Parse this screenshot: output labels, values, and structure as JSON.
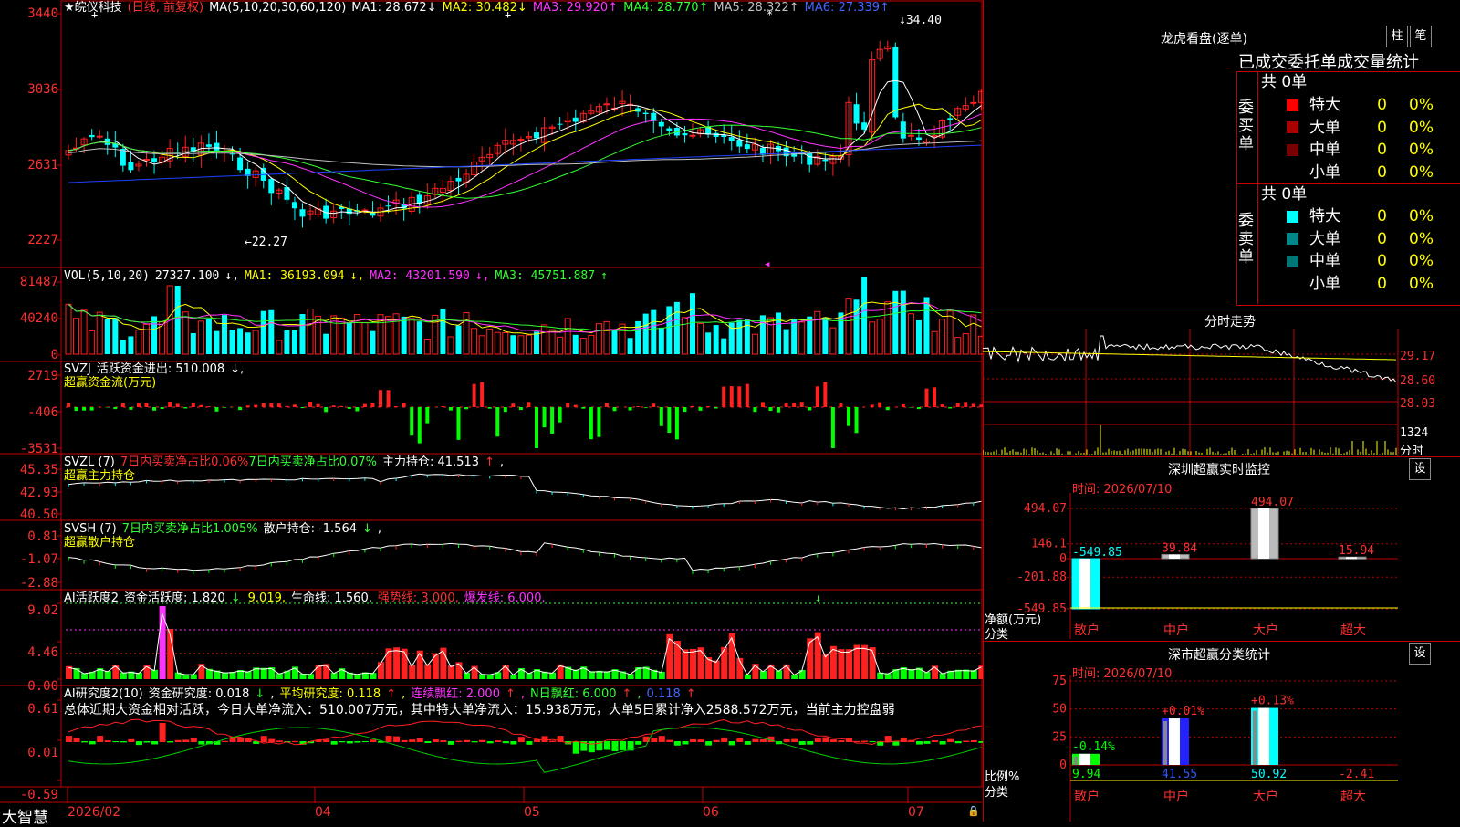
{
  "app": {
    "brand": "大智慧",
    "stock_name": "皖仪科技",
    "period": "(日线, 前复权)"
  },
  "price": {
    "y_labels": [
      "3440",
      "3036",
      "2631",
      "2227"
    ],
    "ma_header": "MA(5,10,20,30,60,120)",
    "ma": [
      {
        "label": "MA1:",
        "value": "28.672",
        "arrow": "↓",
        "color": "#ffffff"
      },
      {
        "label": "MA2:",
        "value": "30.482",
        "arrow": "↓",
        "color": "#ffff00"
      },
      {
        "label": "MA3:",
        "value": "29.920",
        "arrow": "↑",
        "color": "#ff33ff"
      },
      {
        "label": "MA4:",
        "value": "28.770",
        "arrow": "↑",
        "color": "#33ff33"
      },
      {
        "label": "MA5:",
        "value": "28.322",
        "arrow": "↑",
        "color": "#c0c0c0"
      },
      {
        "label": "MA6:",
        "value": "27.339",
        "arrow": "↑",
        "color": "#4466ff"
      }
    ],
    "high_note": "34.40",
    "low_note": "←22.27",
    "x_axis": [
      "2026/02",
      "04",
      "05",
      "06",
      "07"
    ]
  },
  "vol": {
    "y_labels": [
      "81487",
      "40240",
      "0"
    ],
    "header": "VOL(5,10,20)",
    "value": "27327.100",
    "ma1": "MA1: 36193.094",
    "ma2": "MA2: 43201.590",
    "ma3": "MA3: 45751.887"
  },
  "svzj": {
    "y_labels": [
      "2719",
      "-406",
      "-3531"
    ],
    "header": "SVZJ",
    "label": "活跃资金进出: 510.008",
    "subtitle": "超赢资金流(万元)"
  },
  "svzl": {
    "y_labels": [
      "45.35",
      "42.93",
      "40.50"
    ],
    "header": "SVZL (7)",
    "t1": "7日内买卖净占比0.06%",
    "t2": "7日内买卖净占比0.07%",
    "t3": "主力持仓: 41.513",
    "subtitle": "超赢主力持仓"
  },
  "svsh": {
    "y_labels": [
      "0.81",
      "-1.07",
      "-2.88"
    ],
    "header": "SVSH (7)",
    "t1": "7日内买卖净占比1.005%",
    "t2": "散户持仓: -1.564",
    "subtitle": "超赢散户持仓"
  },
  "ai1": {
    "y_labels": [
      "9.02",
      "4.46",
      "0.00"
    ],
    "header": "AI活跃度2",
    "t1": "资金活跃度: 1.820",
    "t2": "9.019,",
    "t3": "生命线: 1.560,",
    "t4": "强势线: 3.000,",
    "t5": "爆发线: 6.000,"
  },
  "ai2": {
    "y_labels": [
      "0.61",
      "0.01",
      "-0.59"
    ],
    "header": "AI研究度2(10)",
    "t1": "资金研究度: 0.018",
    "t2": "平均研究度: 0.118",
    "t3": "连续飘红: 2.000",
    "t4": "N日飘红: 6.000",
    "t5": "0.118",
    "summary": "总体近期大资金相对活跃，今日大单净流入：510.007万元，其中特大单净流入：15.938万元，大单5日累计净入2588.572万元，当前主力控盘弱"
  },
  "dragon": {
    "title": "龙虎看盘(逐单)",
    "btn1": "柱",
    "btn2": "笔",
    "tabs": "已成交委托单成交量统计",
    "buy_label": "委买单",
    "sell_label": "委卖单",
    "buy_total": "共 0单",
    "sell_total": "共 0单",
    "buy_rows": [
      {
        "name": "特大",
        "count": "0",
        "pct": "0%",
        "color": "#ff0000"
      },
      {
        "name": "大单",
        "count": "0",
        "pct": "0%",
        "color": "#aa0000"
      },
      {
        "name": "中单",
        "count": "0",
        "pct": "0%",
        "color": "#770000"
      },
      {
        "name": "小单",
        "count": "0",
        "pct": "0%",
        "color": "#000000"
      }
    ],
    "sell_rows": [
      {
        "name": "特大",
        "count": "0",
        "pct": "0%",
        "color": "#00ffff"
      },
      {
        "name": "大单",
        "count": "0",
        "pct": "0%",
        "color": "#008888"
      },
      {
        "name": "中单",
        "count": "0",
        "pct": "0%",
        "color": "#007777"
      },
      {
        "name": "小单",
        "count": "0",
        "pct": "0%",
        "color": "#000000"
      }
    ]
  },
  "intraday": {
    "title": "分时走势",
    "y_labels": [
      "29.17",
      "28.60",
      "28.03"
    ],
    "vol_label": "1324",
    "vol_unit": "分时"
  },
  "monitor": {
    "title": "深圳超赢实时监控",
    "btn": "设",
    "time": "时间: 2026/07/10",
    "y_labels": [
      "494.07",
      "146.1",
      "0",
      "-201.88",
      "-549.85"
    ],
    "axis_label": "净额(万元)",
    "axis_label2": "分类",
    "categories": [
      "散户",
      "中户",
      "大户",
      "超大"
    ],
    "values": [
      -549.85,
      39.84,
      494.07,
      15.94
    ],
    "value_labels": [
      "-549.85",
      "39.84",
      "494.07",
      "15.94"
    ]
  },
  "classify": {
    "title": "深市超赢分类统计",
    "btn": "设",
    "time": "时间: 2026/07/10",
    "y_labels": [
      "75",
      "50",
      "25",
      "0"
    ],
    "axis_label": "比例%",
    "axis_label2": "分类",
    "categories": [
      "散户",
      "中户",
      "大户",
      "超大"
    ],
    "values": [
      9.94,
      41.55,
      50.92,
      -2.41
    ],
    "bottom_labels": [
      "9.94",
      "41.55",
      "50.92",
      "-2.41"
    ],
    "change_labels": [
      "-0.14%",
      "+0.01%",
      "+0.13%",
      ""
    ]
  },
  "colors": {
    "up": "#ff2020",
    "down": "#00ffff",
    "grid": "#c00000",
    "yellow": "#ffff00"
  }
}
